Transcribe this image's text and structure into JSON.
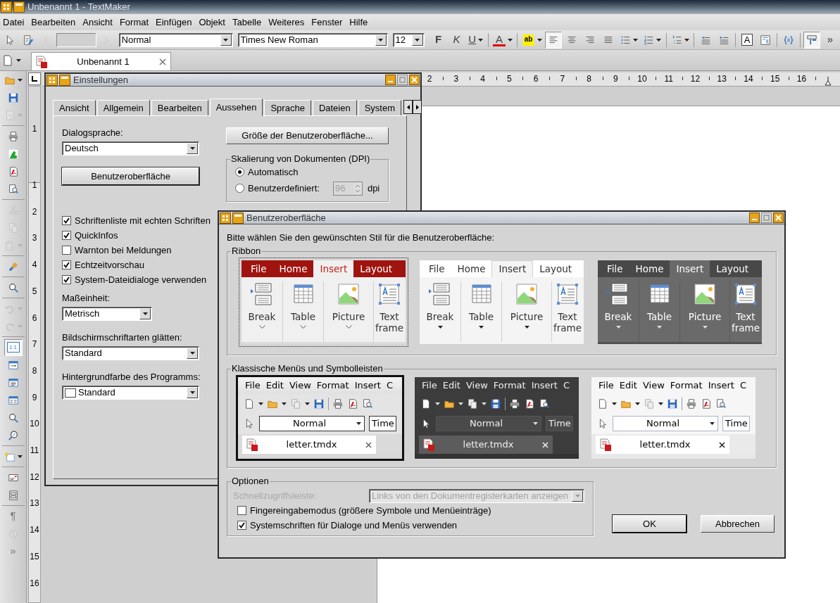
{
  "window": {
    "title": "Unbenannt 1 - TextMaker"
  },
  "menu": [
    "Datei",
    "Bearbeiten",
    "Ansicht",
    "Format",
    "Einfügen",
    "Objekt",
    "Tabelle",
    "Weiteres",
    "Fenster",
    "Hilfe"
  ],
  "toolbar": [
    {
      "kind": "pointer",
      "disabled": false,
      "pressed": false
    },
    {
      "kind": "edit",
      "disabled": false,
      "pressed": false
    },
    {
      "kind": "back",
      "disabled": true,
      "pressed": false
    },
    {
      "kind": "page_field"
    },
    {
      "kind": "forward",
      "disabled": true,
      "pressed": false
    },
    {
      "kind": "style",
      "value": "Normal"
    },
    {
      "kind": "font",
      "value": "Times New Roman"
    },
    {
      "kind": "size",
      "value": "12"
    },
    {
      "kind": "bold",
      "label": "F",
      "disabled": false,
      "pressed": false
    },
    {
      "kind": "italic",
      "label": "K",
      "disabled": false,
      "pressed": false
    },
    {
      "kind": "underline",
      "label": "U",
      "disabled": false,
      "pressed": false
    },
    {
      "kind": "separator"
    },
    {
      "kind": "font_color",
      "label": "A",
      "disabled": false,
      "pressed": false
    },
    {
      "kind": "separator"
    },
    {
      "kind": "highlight",
      "label": "ab",
      "disabled": false,
      "pressed": false
    },
    {
      "kind": "align_left",
      "disabled": false,
      "pressed": true
    },
    {
      "kind": "align_center",
      "disabled": false,
      "pressed": false
    },
    {
      "kind": "align_right",
      "disabled": false,
      "pressed": false
    },
    {
      "kind": "justify",
      "disabled": false,
      "pressed": false
    },
    {
      "kind": "bullets",
      "disabled": false,
      "pressed": false
    },
    {
      "kind": "numbering",
      "disabled": false,
      "pressed": false
    },
    {
      "kind": "separator"
    },
    {
      "kind": "outline",
      "disabled": false,
      "pressed": false
    },
    {
      "kind": "separator"
    },
    {
      "kind": "indent_less",
      "disabled": false,
      "pressed": false
    },
    {
      "kind": "indent_more",
      "disabled": false,
      "pressed": false
    },
    {
      "kind": "separator"
    },
    {
      "kind": "textbox",
      "label": "A",
      "disabled": false,
      "pressed": false
    },
    {
      "kind": "paragraph_style",
      "disabled": false,
      "pressed": false
    },
    {
      "kind": "separator"
    },
    {
      "kind": "field",
      "disabled": false,
      "pressed": false
    },
    {
      "kind": "separator"
    },
    {
      "kind": "ruler_toggle",
      "disabled": false,
      "pressed": true
    },
    {
      "kind": "more",
      "label": "»",
      "disabled": false,
      "pressed": false
    }
  ],
  "document_tabs": [
    {
      "label": "Unbenannt 1",
      "selected": true
    }
  ],
  "side_toolbar": [
    {
      "kind": "open",
      "disabled": false,
      "pressed": false
    },
    {
      "kind": "save",
      "disabled": false,
      "pressed": false
    },
    {
      "kind": "revert",
      "disabled": true,
      "pressed": false
    },
    {
      "kind": "separator"
    },
    {
      "kind": "print",
      "disabled": false,
      "pressed": false
    },
    {
      "kind": "image",
      "disabled": false,
      "pressed": false
    },
    {
      "kind": "pdf",
      "disabled": false,
      "pressed": false
    },
    {
      "kind": "preview",
      "disabled": false,
      "pressed": false
    },
    {
      "kind": "separator"
    },
    {
      "kind": "cut",
      "disabled": true,
      "pressed": false
    },
    {
      "kind": "copy",
      "disabled": true,
      "pressed": false
    },
    {
      "kind": "paste",
      "disabled": true,
      "pressed": false
    },
    {
      "kind": "separator"
    },
    {
      "kind": "brush",
      "disabled": false,
      "pressed": false
    },
    {
      "kind": "separator"
    },
    {
      "kind": "search",
      "disabled": false,
      "pressed": false
    },
    {
      "kind": "separator"
    },
    {
      "kind": "undo",
      "disabled": true,
      "pressed": false
    },
    {
      "kind": "redo",
      "disabled": true,
      "pressed": false
    },
    {
      "kind": "separator"
    },
    {
      "kind": "zoom_11",
      "label": "1:1",
      "disabled": false,
      "pressed": true
    },
    {
      "kind": "page_view",
      "disabled": false,
      "pressed": false
    },
    {
      "kind": "doc_view",
      "disabled": false,
      "pressed": false
    },
    {
      "kind": "columns_view",
      "disabled": false,
      "pressed": false
    },
    {
      "kind": "zoom",
      "disabled": false,
      "pressed": false
    },
    {
      "kind": "zoom_percent",
      "disabled": false,
      "pressed": false
    },
    {
      "kind": "separator"
    },
    {
      "kind": "frame",
      "disabled": false,
      "pressed": false
    },
    {
      "kind": "separator"
    },
    {
      "kind": "envelope",
      "disabled": false,
      "pressed": false
    },
    {
      "kind": "form",
      "disabled": false,
      "pressed": false
    },
    {
      "kind": "separator"
    },
    {
      "kind": "pilcrow",
      "label": "¶",
      "disabled": true,
      "pressed": false
    },
    {
      "kind": "globe",
      "disabled": true,
      "pressed": false
    },
    {
      "kind": "more",
      "label": "»",
      "disabled": true,
      "pressed": false
    }
  ],
  "rulers": {
    "horizontal": [
      "2",
      "3",
      "4",
      "5",
      "6",
      "7",
      "8",
      "9",
      "10",
      "11",
      "12",
      "13",
      "14",
      "15",
      "16"
    ],
    "vertical": [
      "1",
      "1",
      "2",
      "3",
      "4",
      "5",
      "6",
      "7",
      "8",
      "9",
      "10",
      "11",
      "12",
      "13",
      "14",
      "15",
      "16"
    ]
  },
  "settings_dialog": {
    "title": "Einstellungen",
    "tabs": [
      {
        "label": "Ansicht",
        "selected": false
      },
      {
        "label": "Allgemein",
        "selected": false
      },
      {
        "label": "Bearbeiten",
        "selected": false
      },
      {
        "label": "Aussehen",
        "selected": true
      },
      {
        "label": "Sprache",
        "selected": false
      },
      {
        "label": "Dateien",
        "selected": false
      },
      {
        "label": "System",
        "selected": false
      }
    ],
    "dialog_language": {
      "label": "Dialogsprache:",
      "value": "Deutsch"
    },
    "ui_button": "Benutzeroberfläche",
    "ui_size_button": "Größe der Benutzeroberfläche...",
    "dpi_group": {
      "title": "Skalierung von Dokumenten (DPI)",
      "options": [
        {
          "label": "Automatisch",
          "selected": true
        },
        {
          "label": "Benutzerdefiniert:",
          "selected": false
        }
      ],
      "value": "96",
      "disabled": true,
      "unit": "dpi"
    },
    "checkboxes": [
      {
        "label": "Schriftenliste mit echten Schriften",
        "checked": true
      },
      {
        "label": "QuickInfos",
        "checked": true
      },
      {
        "label": "Warnton bei Meldungen",
        "checked": false
      },
      {
        "label": "Echtzeitvorschau",
        "checked": true
      },
      {
        "label": "System-Dateidialoge verwenden",
        "checked": true
      }
    ],
    "unit": {
      "label": "Maßeinheit:",
      "value": "Metrisch"
    },
    "smoothing": {
      "label": "Bildschirmschriftarten glätten:",
      "value": "Standard"
    },
    "background": {
      "label": "Hintergrundfarbe des Programms:",
      "value": "Standard"
    }
  },
  "ui_dialog": {
    "title": "Benutzeroberfläche",
    "prompt": "Bitte wählen Sie den gewünschten Stil für die Benutzeroberfläche:",
    "ribbon_group": {
      "title": "Ribbon",
      "styles": [
        {
          "kind": "red",
          "selected": true,
          "tabs": [
            {
              "label": "File",
              "selected": false
            },
            {
              "label": "Home",
              "selected": false
            },
            {
              "label": "Insert",
              "selected": true
            },
            {
              "label": "Layout",
              "selected": false
            }
          ],
          "commands": [
            {
              "kind": "break",
              "label": "Break"
            },
            {
              "kind": "table",
              "label": "Table"
            },
            {
              "kind": "picture",
              "label": "Picture"
            },
            {
              "kind": "text_frame",
              "label": "Text frame"
            }
          ]
        },
        {
          "kind": "light",
          "selected": false,
          "tabs": [
            {
              "label": "File",
              "selected": false
            },
            {
              "label": "Home",
              "selected": false
            },
            {
              "label": "Insert",
              "selected": true
            },
            {
              "label": "Layout",
              "selected": false
            }
          ],
          "commands": [
            {
              "kind": "break",
              "label": "Break"
            },
            {
              "kind": "table",
              "label": "Table"
            },
            {
              "kind": "picture",
              "label": "Picture"
            },
            {
              "kind": "text_frame",
              "label": "Text frame"
            }
          ]
        },
        {
          "kind": "dark",
          "selected": false,
          "tabs": [
            {
              "label": "File",
              "selected": false
            },
            {
              "label": "Home",
              "selected": false
            },
            {
              "label": "Insert",
              "selected": true
            },
            {
              "label": "Layout",
              "selected": false
            }
          ],
          "commands": [
            {
              "kind": "break",
              "label": "Break"
            },
            {
              "kind": "table",
              "label": "Table"
            },
            {
              "kind": "picture",
              "label": "Picture"
            },
            {
              "kind": "text_frame",
              "label": "Text frame"
            }
          ]
        }
      ]
    },
    "classic_group": {
      "title": "Klassische Menüs und Symbolleisten",
      "styles": [
        {
          "kind": "light",
          "selected": true,
          "menu": [
            "File",
            "Edit",
            "View",
            "Format",
            "Insert",
            "C"
          ],
          "style": "Normal",
          "font": "Time",
          "tab": "letter.tmdx"
        },
        {
          "kind": "dark",
          "selected": false,
          "menu": [
            "File",
            "Edit",
            "View",
            "Format",
            "Insert",
            "C"
          ],
          "style": "Normal",
          "font": "Time",
          "tab": "letter.tmdx"
        },
        {
          "kind": "modern",
          "selected": false,
          "menu": [
            "File",
            "Edit",
            "View",
            "Format",
            "Insert",
            "C"
          ],
          "style": "Normal",
          "font": "Time",
          "tab": "letter.tmdx"
        }
      ]
    },
    "options": {
      "title": "Optionen",
      "quick_access": {
        "label": "Schnellzugriffsleiste:",
        "value": "Links von den Dokumentregisterkarten anzeigen",
        "disabled": true
      },
      "checkboxes": [
        {
          "label": "Fingereingabemodus (größere Symbole und Menüeinträge)",
          "checked": false
        },
        {
          "label": "Systemschriften für Dialoge und Menüs verwenden",
          "checked": true
        }
      ]
    },
    "buttons": [
      {
        "label": "OK",
        "default": true
      },
      {
        "label": "Abbrechen",
        "default": false
      }
    ]
  }
}
